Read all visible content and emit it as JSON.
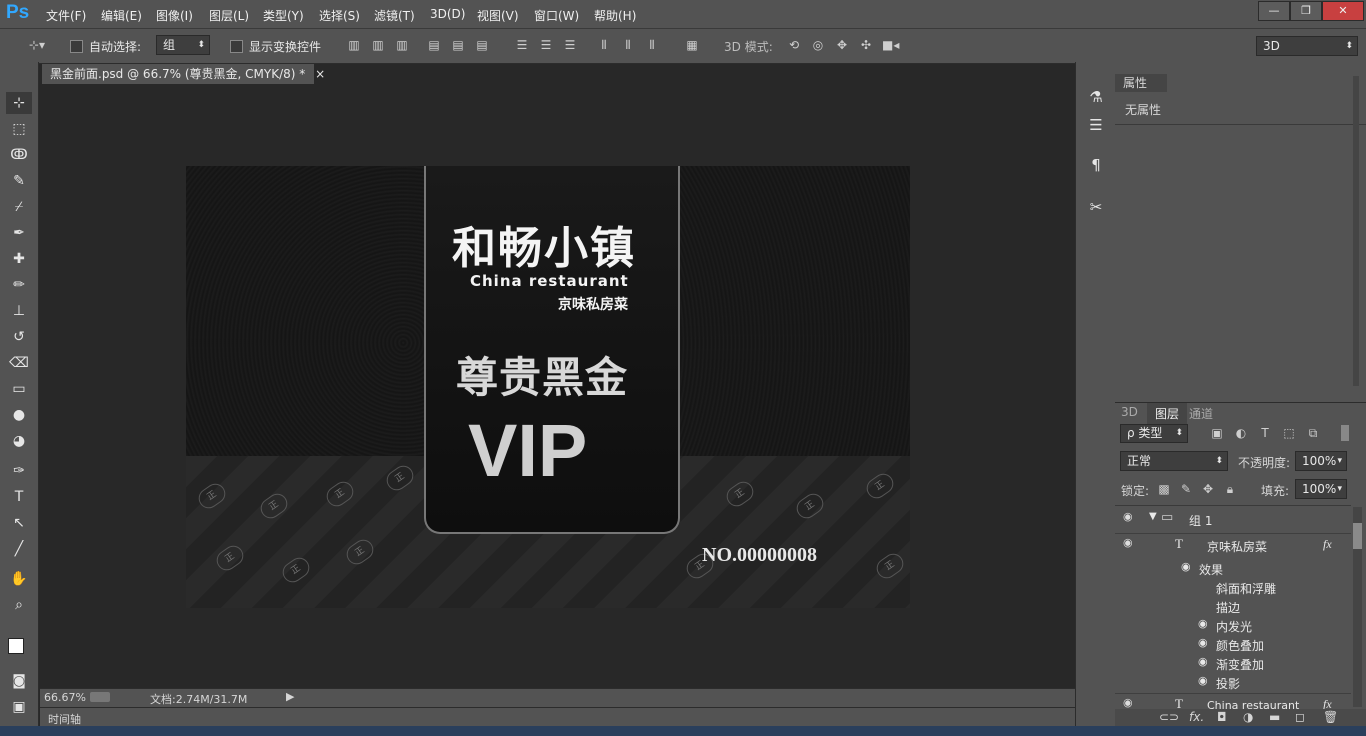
{
  "app": {
    "logo": "Ps"
  },
  "menu": [
    "文件(F)",
    "编辑(E)",
    "图像(I)",
    "图层(L)",
    "类型(Y)",
    "选择(S)",
    "滤镜(T)",
    "3D(D)",
    "视图(V)",
    "窗口(W)",
    "帮助(H)"
  ],
  "window_buttons": {
    "minimize": "—",
    "restore": "❐",
    "close": "✕"
  },
  "options": {
    "auto_select_label": "自动选择:",
    "auto_select_value": "组",
    "show_transform_label": "显示变换控件",
    "mode_3d_label": "3D 模式:",
    "workspace_value": "3D"
  },
  "document": {
    "tab_title": "黑金前面.psd @ 66.7% (尊贵黑金, CMYK/8) *",
    "tab_close": "×"
  },
  "card": {
    "title_cn": "和畅小镇",
    "subtitle_en": "China restaurant",
    "subtitle_cn": "京味私房菜",
    "tier_cn": "尊贵黑金",
    "vip": "VIP",
    "number": "NO.00000008",
    "coin_glyph": "正"
  },
  "status": {
    "zoom": "66.67%",
    "doc_info": "文档:2.74M/31.7M",
    "timeline": "时间轴"
  },
  "properties": {
    "tab": "属性",
    "empty": "无属性"
  },
  "layers_panel": {
    "tabs": [
      "3D",
      "图层",
      "通道"
    ],
    "filter_label": "ρ 类型",
    "blend_mode": "正常",
    "opacity_label": "不透明度:",
    "opacity_value": "100%",
    "lock_label": "锁定:",
    "fill_label": "填充:",
    "fill_value": "100%",
    "rows": [
      {
        "name": "组 1",
        "kind": "group"
      },
      {
        "name": "京味私房菜",
        "kind": "text",
        "fx": "fx"
      },
      {
        "name": "效果",
        "kind": "effects"
      },
      {
        "name": "斜面和浮雕",
        "kind": "effect"
      },
      {
        "name": "描边",
        "kind": "effect"
      },
      {
        "name": "内发光",
        "kind": "effect"
      },
      {
        "name": "颜色叠加",
        "kind": "effect"
      },
      {
        "name": "渐变叠加",
        "kind": "effect"
      },
      {
        "name": "投影",
        "kind": "effect"
      },
      {
        "name": "China restaurant",
        "kind": "text",
        "fx": "fx"
      }
    ]
  },
  "colors": {
    "chrome": "#535353",
    "workspace": "#282828",
    "accent": "#31a8ff"
  }
}
